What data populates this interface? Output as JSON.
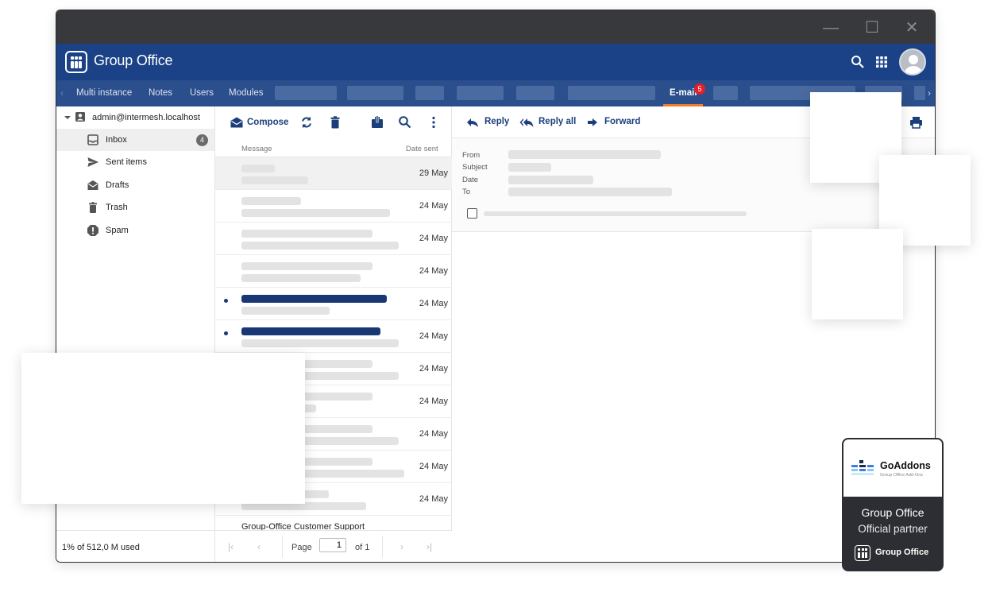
{
  "app": {
    "title": "Group Office"
  },
  "tabs": [
    "Multi instance",
    "Notes",
    "Users",
    "Modules",
    "E-mail"
  ],
  "email_badge": "5",
  "account": "admin@intermesh.localhost",
  "folders": [
    {
      "label": "Inbox",
      "icon": "inbox-icon",
      "count": "4"
    },
    {
      "label": "Sent items",
      "icon": "send-icon"
    },
    {
      "label": "Drafts",
      "icon": "drafts-icon"
    },
    {
      "label": "Trash",
      "icon": "trash-icon"
    },
    {
      "label": "Spam",
      "icon": "spam-icon"
    }
  ],
  "quota": "1% of 512,0 M used",
  "list_toolbar": {
    "compose": "Compose"
  },
  "list_columns": {
    "message": "Message",
    "date": "Date sent"
  },
  "rows": [
    {
      "date": "29 May",
      "selected": true,
      "unread": false
    },
    {
      "date": "24 May",
      "unread": false
    },
    {
      "date": "24 May",
      "unread": false
    },
    {
      "date": "24 May",
      "unread": false
    },
    {
      "date": "24 May",
      "unread": true
    },
    {
      "date": "24 May",
      "unread": true
    },
    {
      "date": "24 May",
      "unread": false
    },
    {
      "date": "24 May",
      "unread": false
    },
    {
      "date": "24 May",
      "unread": false
    },
    {
      "date": "24 May",
      "unread": false
    },
    {
      "date": "24 May",
      "unread": false
    }
  ],
  "cut_row_text": "Group-Office Customer Support",
  "pager": {
    "page_label": "Page",
    "page_value": "1",
    "of_label": "of 1"
  },
  "reading_toolbar": {
    "reply": "Reply",
    "reply_all": "Reply all",
    "forward": "Forward"
  },
  "header_labels": {
    "from": "From",
    "subject": "Subject",
    "date": "Date",
    "to": "To"
  },
  "partner": {
    "brand": "GoAddons",
    "brand_sub": "Group Office Add-Ons",
    "line1": "Group Office",
    "line2": "Official partner",
    "logo_text": "Group Office"
  },
  "colors": {
    "appbar": "#1b4286",
    "tabbar": "#2b4e8c",
    "accent": "#f07c2e",
    "badge": "#e0202a",
    "unread": "#173874"
  }
}
